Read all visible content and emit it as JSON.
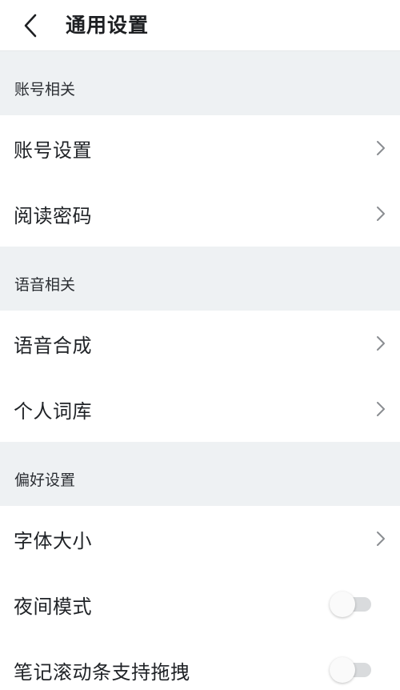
{
  "header": {
    "title": "通用设置",
    "back_icon": "chevron-left-icon"
  },
  "sections": [
    {
      "title": "账号相关",
      "items": [
        {
          "label": "账号设置",
          "control": "chevron"
        },
        {
          "label": "阅读密码",
          "control": "chevron"
        }
      ]
    },
    {
      "title": "语音相关",
      "items": [
        {
          "label": "语音合成",
          "control": "chevron"
        },
        {
          "label": "个人词库",
          "control": "chevron"
        }
      ]
    },
    {
      "title": "偏好设置",
      "items": [
        {
          "label": "字体大小",
          "control": "chevron"
        },
        {
          "label": "夜间模式",
          "control": "toggle",
          "on": false
        },
        {
          "label": "笔记滚动条支持拖拽",
          "control": "toggle",
          "on": false
        }
      ]
    }
  ],
  "colors": {
    "section_bg": "#eef1f3",
    "chevron": "#8a8d91",
    "toggle_track_off": "#d9dbdd"
  }
}
